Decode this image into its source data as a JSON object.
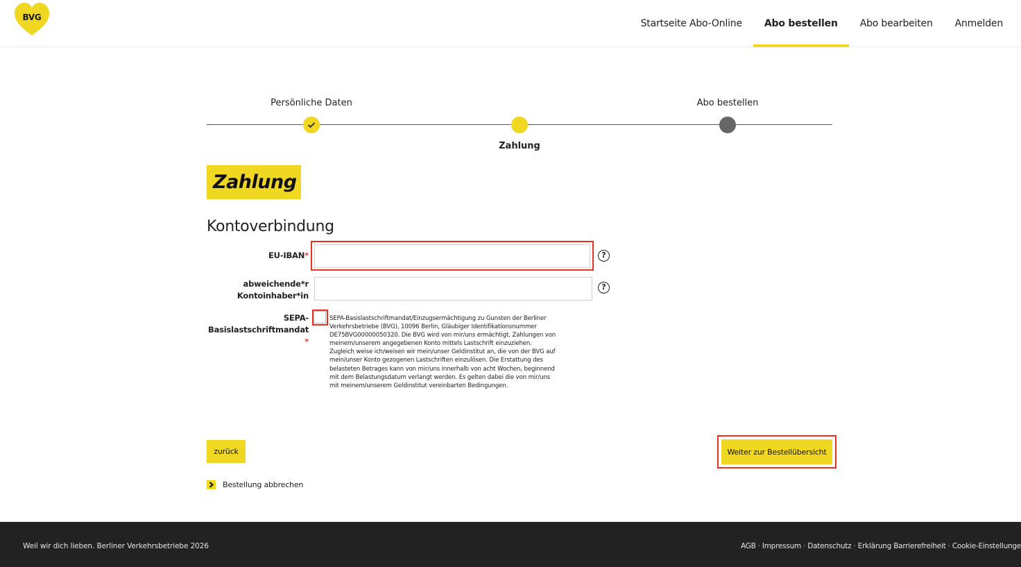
{
  "brand": {
    "logo_text": "BVG",
    "accent_color": "#f0d722",
    "highlight_color": "#e8321e"
  },
  "nav": {
    "items": [
      {
        "label": "Startseite Abo-Online"
      },
      {
        "label": "Abo bestellen",
        "active": true
      },
      {
        "label": "Abo bearbeiten"
      },
      {
        "label": "Anmelden"
      }
    ]
  },
  "stepper": {
    "steps": [
      {
        "label": "Persönliche Daten",
        "state": "done"
      },
      {
        "label": "Zahlung",
        "state": "current"
      },
      {
        "label": "Abo bestellen",
        "state": "todo"
      }
    ]
  },
  "page": {
    "title": "Zahlung",
    "section_title": "Kontoverbindung"
  },
  "form": {
    "iban": {
      "label": "EU-IBAN",
      "required_mark": "*",
      "value": ""
    },
    "holder": {
      "label_line1": "abweichende*r",
      "label_line2": "Kontoinhaber*in",
      "value": ""
    },
    "sepa": {
      "label_line1": "SEPA-",
      "label_line2": "Basislastschriftmandat",
      "required_mark": "*",
      "checked": false,
      "text": "SEPA-Basislastschriftmandat/Einzugsermächtigung zu Gunsten der Berliner Verkehrsbetriebe (BVG), 10096 Berlin, Gläubiger Identifikationsnummer DE75BVG00000050320. Die BVG wird von mir/uns ermächtigt, Zahlungen von meinem/unserem angegebenen Konto mittels Lastschrift einzuziehen. Zugleich weise ich/weisen wir mein/unser Geldinstitut an, die von der BVG auf mein/unser Konto gezogenen Lastschriften einzulösen. Die Erstattung des belasteten Betrages kann von mir/uns innerhalb von acht Wochen, beginnend mit dem Belastungsdatum verlangt werden. Es gelten dabei die von mir/uns mit meinem/unserem Geldinstitut vereinbarten Bedingungen."
    },
    "help_icon": "?"
  },
  "buttons": {
    "back": "zurück",
    "next": "Weiter zur Bestellübersicht",
    "cancel": "Bestellung abbrechen"
  },
  "footer": {
    "tagline": "Weil wir dich lieben. Berliner Verkehrsbetriebe 2026",
    "links": [
      "AGB",
      "Impressum",
      "Datenschutz",
      "Erklärung Barrierefreiheit",
      "Cookie-Einstellungen"
    ],
    "separator": " · "
  }
}
